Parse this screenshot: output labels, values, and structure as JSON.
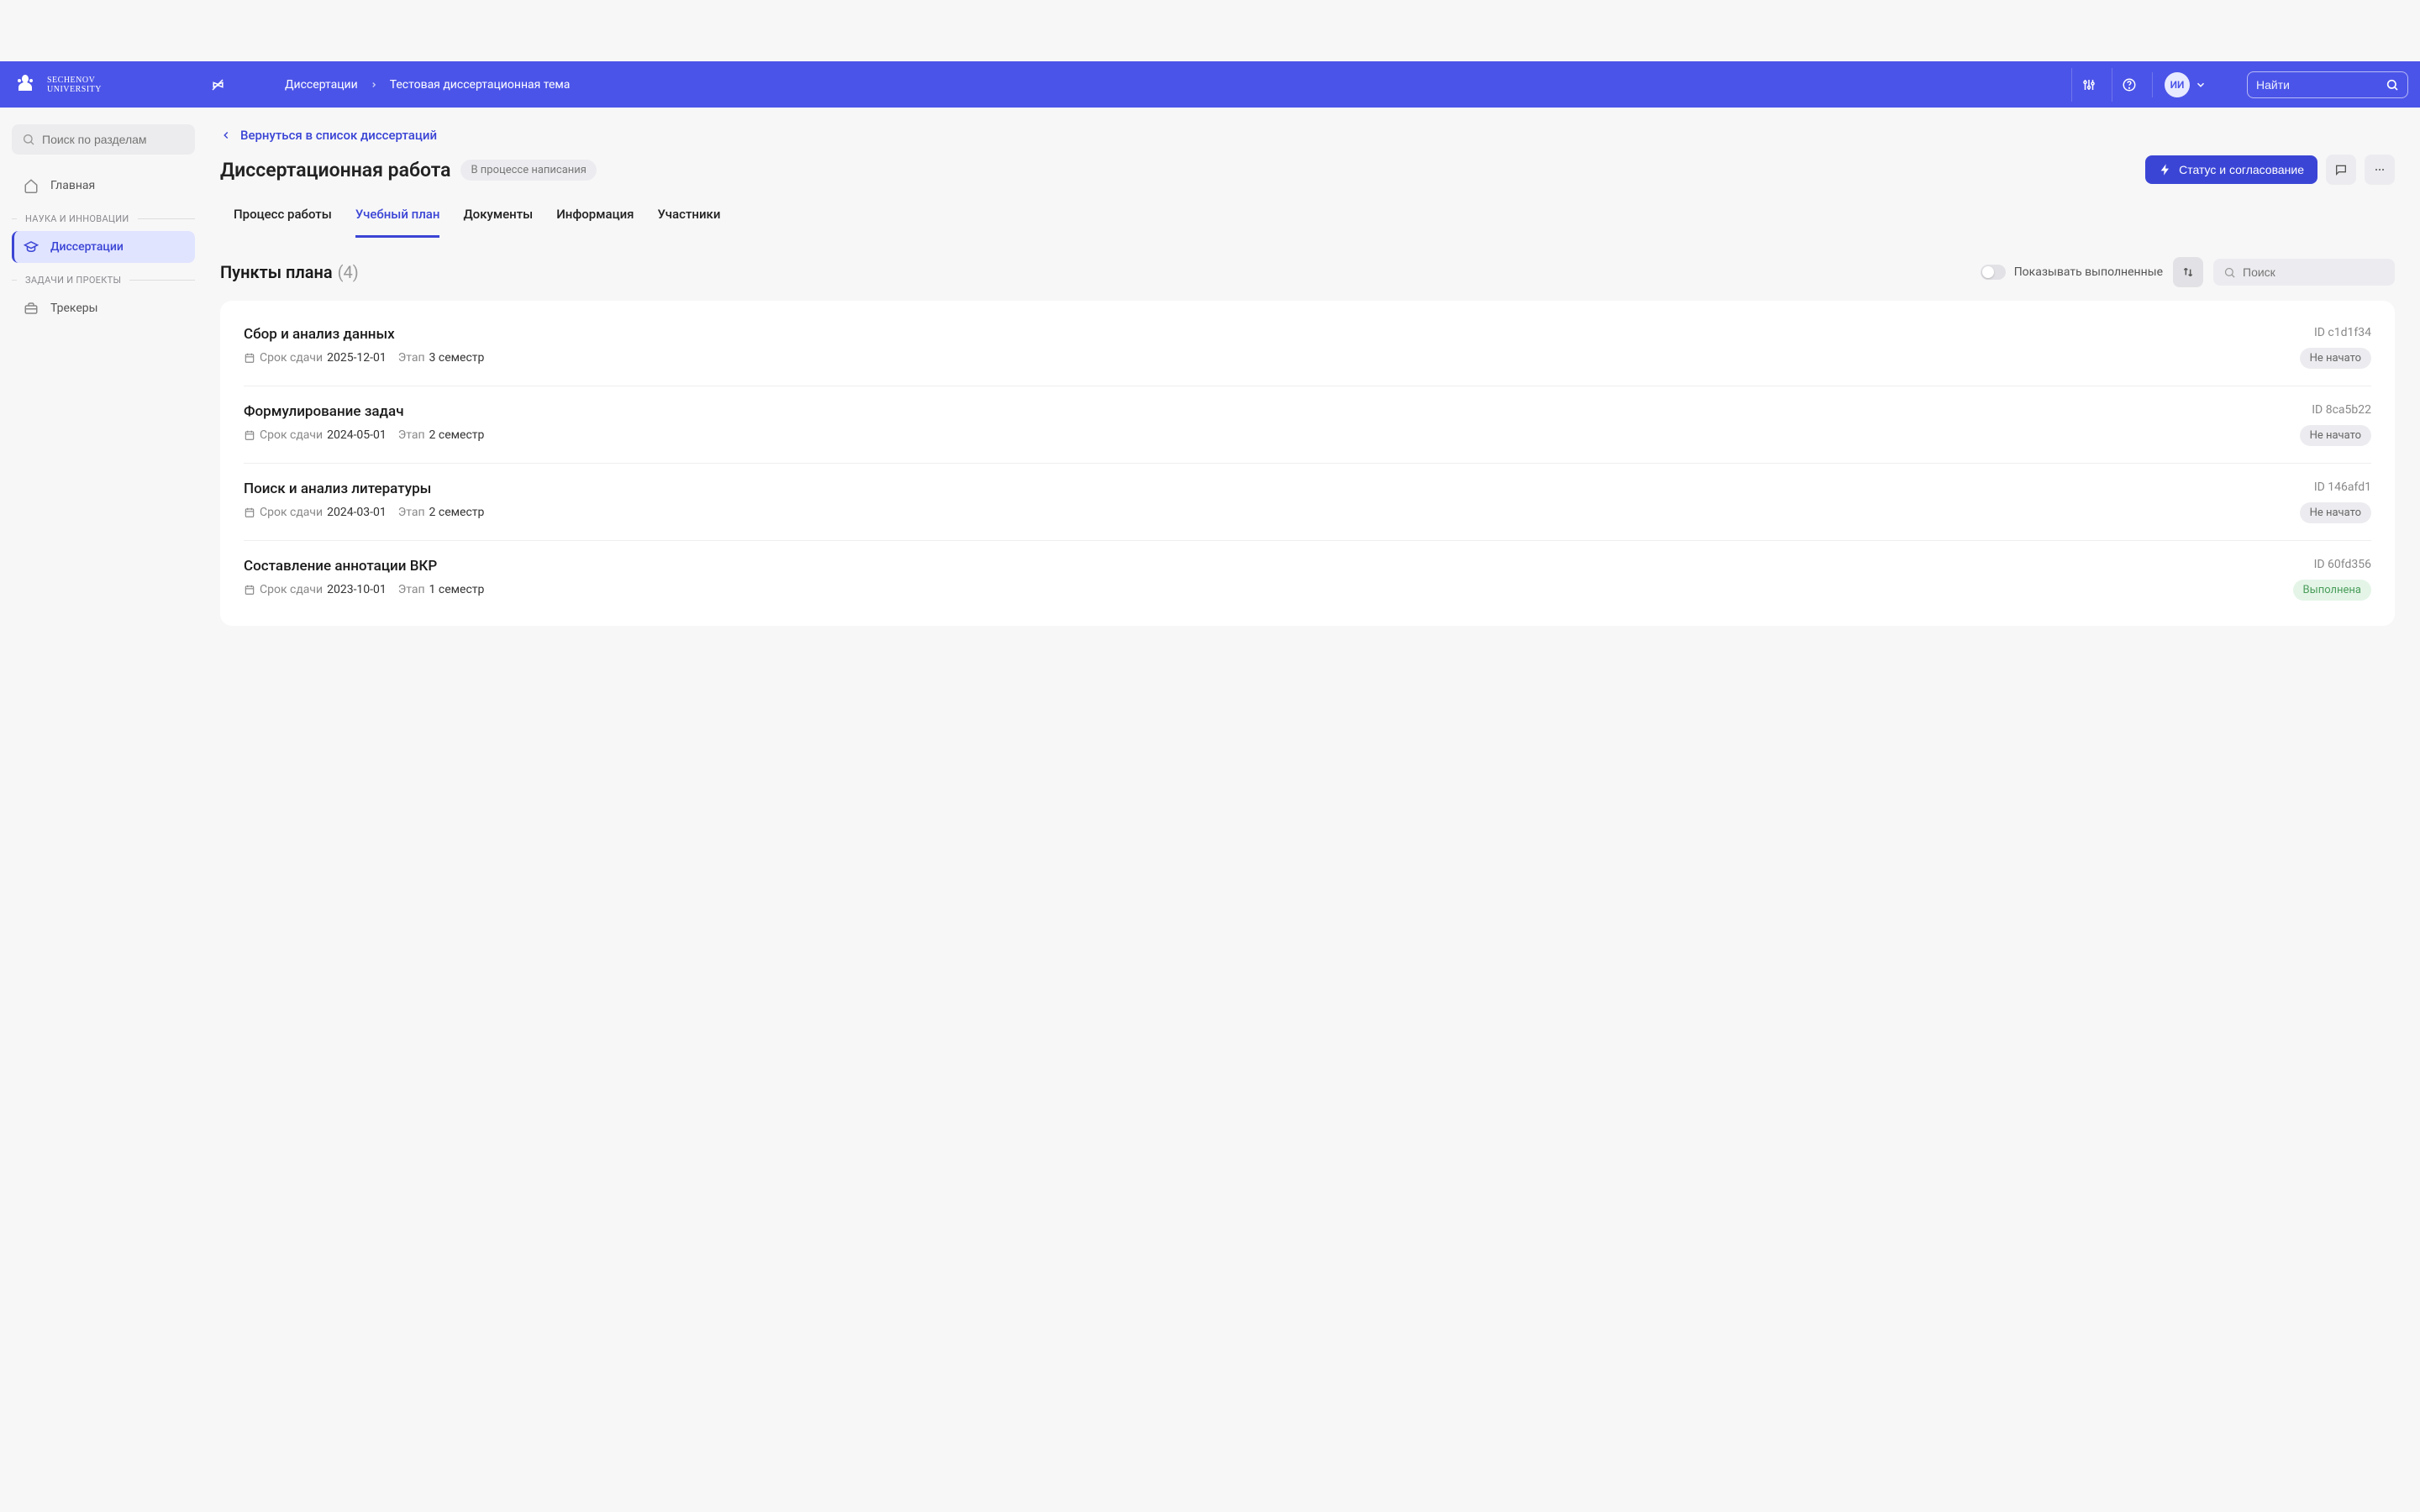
{
  "topbar": {
    "logo_line1": "SECHENOV",
    "logo_line2": "UNIVERSITY",
    "breadcrumb": [
      "Диссертации",
      "Тестовая диссертационная тема"
    ],
    "avatar_initials": "ИИ",
    "search_placeholder": "Найти"
  },
  "sidebar": {
    "search_placeholder": "Поиск по разделам",
    "item_home": "Главная",
    "group_science": "НАУКА И ИННОВАЦИИ",
    "item_dissertations": "Диссертации",
    "group_tasks": "ЗАДАЧИ И ПРОЕКТЫ",
    "item_trackers": "Трекеры"
  },
  "page": {
    "back_link": "Вернуться в список диссертаций",
    "title": "Диссертационная работа",
    "status_pill": "В процессе написания",
    "primary_button": "Статус и согласование"
  },
  "tabs": {
    "process": "Процесс работы",
    "plan": "Учебный план",
    "documents": "Документы",
    "info": "Информация",
    "participants": "Участники"
  },
  "section": {
    "title": "Пункты плана",
    "count": "(4)",
    "toggle_label": "Показывать выполненные",
    "search_placeholder": "Поиск"
  },
  "labels": {
    "deadline": "Срок сдачи",
    "stage": "Этап",
    "id_prefix": "ID"
  },
  "plans": [
    {
      "title": "Сбор и анализ данных",
      "deadline": "2025-12-01",
      "stage": "3 семестр",
      "id": "c1d1f34",
      "status": "Не начато",
      "status_type": "pending"
    },
    {
      "title": "Формулирование задач",
      "deadline": "2024-05-01",
      "stage": "2 семестр",
      "id": "8ca5b22",
      "status": "Не начато",
      "status_type": "pending"
    },
    {
      "title": "Поиск и анализ литературы",
      "deadline": "2024-03-01",
      "stage": "2 семестр",
      "id": "146afd1",
      "status": "Не начато",
      "status_type": "pending"
    },
    {
      "title": "Составление аннотации ВКР",
      "deadline": "2023-10-01",
      "stage": "1 семестр",
      "id": "60fd356",
      "status": "Выполнена",
      "status_type": "done"
    }
  ]
}
